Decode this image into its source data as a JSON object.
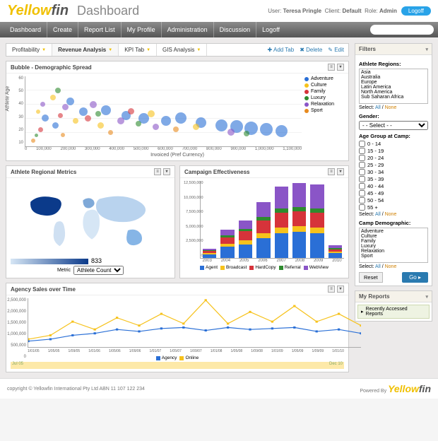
{
  "brand": {
    "part1": "Yellow",
    "part2": "fin"
  },
  "page_title": "Dashboard",
  "user": {
    "label_user": "User:",
    "name": "Teresa Pringle",
    "label_client": "Client:",
    "client": "Default",
    "label_role": "Role:",
    "role": "Admin"
  },
  "logoff_btn": "Logoff",
  "nav": [
    "Dashboard",
    "Create",
    "Report List",
    "My Profile",
    "Administration",
    "Discussion",
    "Logoff"
  ],
  "search_placeholder": "",
  "tabs": [
    {
      "label": "Profitability",
      "active": false
    },
    {
      "label": "Revenue Analysis",
      "active": true
    },
    {
      "label": "KPI Tab",
      "active": false
    },
    {
      "label": "GIS Analysis",
      "active": false
    }
  ],
  "tab_actions": {
    "add": "Add Tab",
    "delete": "Delete",
    "edit": "Edit"
  },
  "panels": {
    "bubble": {
      "title": "Bubble - Demographic Spread",
      "xlabel": "Invoiced (Pref Currency)",
      "ylabel": "Athlete Age"
    },
    "regional": {
      "title": "Athlete Regional Metrics",
      "max_label": "833",
      "metric_label": "Metric",
      "metric_value": "Athlete Count"
    },
    "campaign": {
      "title": "Campaign Effectiveness"
    },
    "agency": {
      "title": "Agency Sales over Time"
    }
  },
  "chart_data": [
    {
      "id": "bubble",
      "type": "scatter",
      "xlabel": "Invoiced (Pref Currency)",
      "ylabel": "Athlete Age",
      "xlim": [
        0,
        1100000
      ],
      "ylim": [
        10,
        60
      ],
      "x_ticks": [
        0,
        100000,
        200000,
        300000,
        400000,
        500000,
        600000,
        700000,
        800000,
        900000,
        1000000,
        1100000
      ],
      "y_ticks": [
        10,
        20,
        30,
        40,
        50,
        60
      ],
      "series_names": [
        "Adventure",
        "Culture",
        "Family",
        "Luxury",
        "Relaxation",
        "Sport"
      ],
      "colors": {
        "Adventure": "#2a6fd6",
        "Culture": "#f6c21c",
        "Family": "#d6333a",
        "Luxury": "#2e8b2e",
        "Relaxation": "#8a55c7",
        "Sport": "#e78a1e"
      },
      "points": [
        {
          "series": "Sport",
          "x": 30000,
          "y": 14,
          "r": 6
        },
        {
          "series": "Luxury",
          "x": 45000,
          "y": 18,
          "r": 5
        },
        {
          "series": "Family",
          "x": 60000,
          "y": 22,
          "r": 7
        },
        {
          "series": "Adventure",
          "x": 80000,
          "y": 30,
          "r": 10
        },
        {
          "series": "Culture",
          "x": 50000,
          "y": 35,
          "r": 6
        },
        {
          "series": "Relaxation",
          "x": 70000,
          "y": 40,
          "r": 7
        },
        {
          "series": "Adventure",
          "x": 120000,
          "y": 25,
          "r": 9
        },
        {
          "series": "Culture",
          "x": 110000,
          "y": 45,
          "r": 8
        },
        {
          "series": "Family",
          "x": 140000,
          "y": 32,
          "r": 7
        },
        {
          "series": "Sport",
          "x": 150000,
          "y": 18,
          "r": 6
        },
        {
          "series": "Luxury",
          "x": 130000,
          "y": 50,
          "r": 8
        },
        {
          "series": "Relaxation",
          "x": 160000,
          "y": 38,
          "r": 9
        },
        {
          "series": "Adventure",
          "x": 180000,
          "y": 42,
          "r": 11
        },
        {
          "series": "Culture",
          "x": 200000,
          "y": 28,
          "r": 8
        },
        {
          "series": "Adventure",
          "x": 230000,
          "y": 35,
          "r": 12
        },
        {
          "series": "Family",
          "x": 250000,
          "y": 30,
          "r": 9
        },
        {
          "series": "Relaxation",
          "x": 270000,
          "y": 40,
          "r": 10
        },
        {
          "series": "Luxury",
          "x": 290000,
          "y": 33,
          "r": 8
        },
        {
          "series": "Adventure",
          "x": 320000,
          "y": 36,
          "r": 14
        },
        {
          "series": "Culture",
          "x": 300000,
          "y": 25,
          "r": 9
        },
        {
          "series": "Sport",
          "x": 340000,
          "y": 20,
          "r": 7
        },
        {
          "series": "Adventure",
          "x": 400000,
          "y": 32,
          "r": 13
        },
        {
          "series": "Relaxation",
          "x": 380000,
          "y": 28,
          "r": 10
        },
        {
          "series": "Family",
          "x": 420000,
          "y": 35,
          "r": 9
        },
        {
          "series": "Adventure",
          "x": 470000,
          "y": 30,
          "r": 15
        },
        {
          "series": "Luxury",
          "x": 450000,
          "y": 26,
          "r": 8
        },
        {
          "series": "Culture",
          "x": 500000,
          "y": 33,
          "r": 10
        },
        {
          "series": "Adventure",
          "x": 560000,
          "y": 28,
          "r": 14
        },
        {
          "series": "Relaxation",
          "x": 520000,
          "y": 24,
          "r": 9
        },
        {
          "series": "Adventure",
          "x": 620000,
          "y": 30,
          "r": 16
        },
        {
          "series": "Sport",
          "x": 600000,
          "y": 22,
          "r": 8
        },
        {
          "series": "Adventure",
          "x": 700000,
          "y": 27,
          "r": 15
        },
        {
          "series": "Culture",
          "x": 680000,
          "y": 24,
          "r": 9
        },
        {
          "series": "Adventure",
          "x": 780000,
          "y": 25,
          "r": 17
        },
        {
          "series": "Adventure",
          "x": 840000,
          "y": 24,
          "r": 18
        },
        {
          "series": "Relaxation",
          "x": 820000,
          "y": 20,
          "r": 10
        },
        {
          "series": "Adventure",
          "x": 900000,
          "y": 23,
          "r": 19
        },
        {
          "series": "Luxury",
          "x": 880000,
          "y": 19,
          "r": 8
        },
        {
          "series": "Adventure",
          "x": 960000,
          "y": 22,
          "r": 18
        },
        {
          "series": "Adventure",
          "x": 1020000,
          "y": 21,
          "r": 17
        }
      ]
    },
    {
      "id": "regional_choropleth",
      "type": "heatmap",
      "title": "Athlete Regional Metrics",
      "metric": "Athlete Count",
      "scale_max": 833,
      "note": "world choropleth, darker=higher"
    },
    {
      "id": "campaign",
      "type": "bar",
      "stacked": true,
      "title": "Campaign Effectiveness",
      "categories": [
        "2003",
        "2004",
        "2005",
        "2006",
        "2007",
        "2008",
        "2009",
        "2010"
      ],
      "ylim": [
        0,
        12500000
      ],
      "y_ticks": [
        0,
        2500000,
        5000000,
        7500000,
        10000000,
        12500000
      ],
      "series": [
        {
          "name": "Agent",
          "color": "#2a6fd6",
          "values": [
            600000,
            1800000,
            2200000,
            3200000,
            4000000,
            4200000,
            4000000,
            800000
          ]
        },
        {
          "name": "Broadcast",
          "color": "#f6c21c",
          "values": [
            200000,
            500000,
            600000,
            800000,
            900000,
            900000,
            900000,
            200000
          ]
        },
        {
          "name": "HardCopy",
          "color": "#d6333a",
          "values": [
            300000,
            1000000,
            1500000,
            2000000,
            2400000,
            2400000,
            2400000,
            400000
          ]
        },
        {
          "name": "Referral",
          "color": "#2e8b2e",
          "values": [
            100000,
            300000,
            400000,
            600000,
            700000,
            700000,
            700000,
            150000
          ]
        },
        {
          "name": "WebView",
          "color": "#8a55c7",
          "values": [
            300000,
            900000,
            1300000,
            2400000,
            3500000,
            3800000,
            3800000,
            450000
          ]
        }
      ]
    },
    {
      "id": "agency",
      "type": "line",
      "title": "Agency Sales over Time",
      "ylim": [
        0,
        2500000
      ],
      "y_ticks": [
        0,
        500000,
        1000000,
        1500000,
        2000000,
        2500000
      ],
      "x": [
        "1/01/05",
        "1/05/05",
        "1/09/05",
        "1/01/06",
        "1/05/06",
        "1/09/06",
        "1/01/07",
        "1/05/07",
        "1/09/07",
        "1/01/08",
        "1/05/08",
        "1/09/08",
        "1/01/09",
        "1/05/09",
        "1/09/09",
        "1/01/10"
      ],
      "series": [
        {
          "name": "Agency",
          "color": "#2a6fd6",
          "values": [
            300000,
            400000,
            600000,
            700000,
            900000,
            800000,
            950000,
            1000000,
            850000,
            1000000,
            900000,
            950000,
            1000000,
            800000,
            900000,
            700000
          ]
        },
        {
          "name": "Online",
          "color": "#f6c21c",
          "values": [
            400000,
            600000,
            1300000,
            900000,
            1500000,
            1100000,
            1700000,
            1200000,
            2400000,
            1200000,
            1800000,
            1300000,
            2100000,
            1300000,
            1700000,
            1100000
          ]
        }
      ],
      "range": {
        "from": "Jul 05",
        "to": "Dec 10"
      }
    }
  ],
  "filters": {
    "title": "Filters",
    "regions": {
      "label": "Athlete Regions:",
      "options": [
        "Asia",
        "Australia",
        "Europe",
        "Latin America",
        "North America",
        "Sub Saharan Africa"
      ]
    },
    "select_text": {
      "prefix": "Select:",
      "all": "All",
      "sep": "/",
      "none": "None"
    },
    "gender": {
      "label": "Gender:",
      "value": "- - Select - -"
    },
    "age": {
      "label": "Age Group at Camp:",
      "options": [
        "0 - 14",
        "15 - 19",
        "20 - 24",
        "25 - 29",
        "30 - 34",
        "35 - 39",
        "40 - 44",
        "45 - 49",
        "50 - 54",
        "55 +"
      ]
    },
    "camp": {
      "label": "Camp Demographic:",
      "options": [
        "Adventure",
        "Culture",
        "Family",
        "Luxury",
        "Relaxation",
        "Sport"
      ]
    },
    "reset": "Reset",
    "go": "Go ▸"
  },
  "my_reports": {
    "title": "My Reports",
    "item": "Recently Accessed Reports"
  },
  "footer": {
    "copy": "copyright © Yellowfin International Pty Ltd ABN 11 107 122 234",
    "powered": "Powered By"
  }
}
